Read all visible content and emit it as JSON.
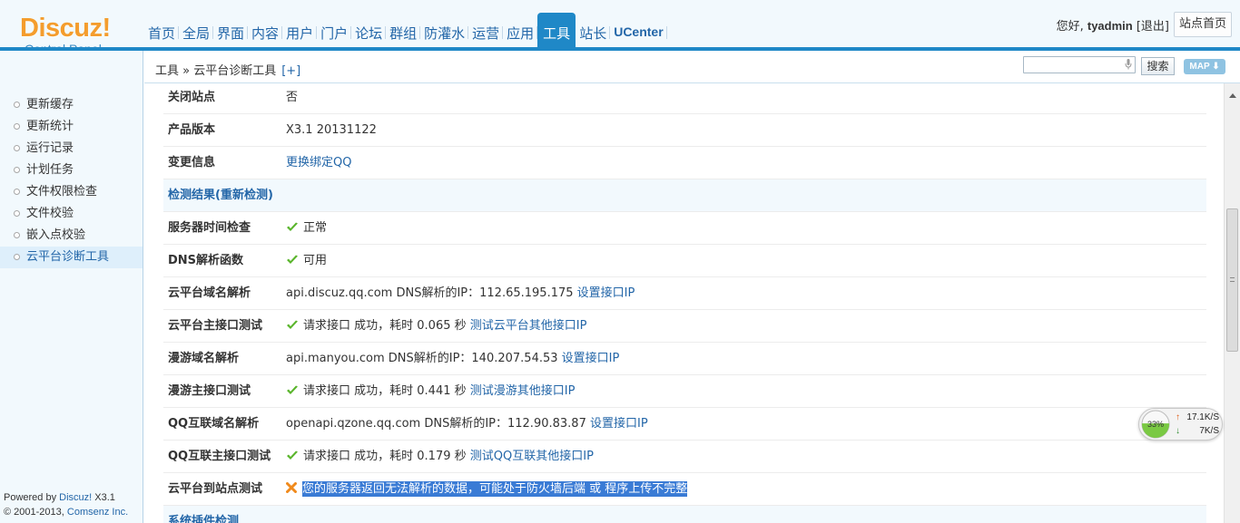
{
  "header": {
    "logo_brand": "Discuz!",
    "logo_sub": "Control Panel",
    "nav": [
      "首页",
      "全局",
      "界面",
      "内容",
      "用户",
      "门户",
      "论坛",
      "群组",
      "防灌水",
      "运营",
      "应用",
      "工具",
      "站长"
    ],
    "nav_ucenter": "UCenter",
    "active_nav": "工具",
    "greeting": "您好,",
    "username": "tyadmin",
    "logout": "[退出]",
    "site_home": "站点首页",
    "accent_color": "#1f88c7",
    "brand_color": "#f49d2d"
  },
  "breadcrumb": {
    "path": "工具 » 云平台诊断工具",
    "plus": "[+]"
  },
  "toolbar": {
    "search_value": "",
    "search_button": "搜索",
    "map_button": "MAP"
  },
  "sidebar": {
    "items": [
      "更新缓存",
      "更新统计",
      "运行记录",
      "计划任务",
      "文件权限检查",
      "文件校验",
      "嵌入点校验",
      "云平台诊断工具"
    ],
    "active_item": "云平台诊断工具",
    "powered_prefix": "Powered by ",
    "powered_brand": "Discuz!",
    "powered_version": " X3.1",
    "copyright_prefix": "© 2001-2013, ",
    "copyright_company": "Comsenz Inc."
  },
  "rows": [
    {
      "label": "关闭站点",
      "text": "否"
    },
    {
      "label": "产品版本",
      "text": "X3.1 20131122"
    },
    {
      "label": "变更信息",
      "link": "更换绑定QQ"
    },
    {
      "label": "检测结果(重新检测)",
      "section": true
    },
    {
      "label": "服务器时间检查",
      "status": "ok",
      "text": "正常"
    },
    {
      "label": "DNS解析函数",
      "status": "ok",
      "text": "可用"
    },
    {
      "label": "云平台域名解析",
      "text": "api.discuz.qq.com DNS解析的IP：112.65.195.175",
      "link": "设置接口IP"
    },
    {
      "label": "云平台主接口测试",
      "status": "ok",
      "text": "请求接口 成功，耗时 0.065 秒",
      "link": "测试云平台其他接口IP"
    },
    {
      "label": "漫游域名解析",
      "text": "api.manyou.com DNS解析的IP：140.207.54.53",
      "link": "设置接口IP"
    },
    {
      "label": "漫游主接口测试",
      "status": "ok",
      "text": "请求接口 成功，耗时 0.441 秒",
      "link": "测试漫游其他接口IP"
    },
    {
      "label": "QQ互联域名解析",
      "text": "openapi.qzone.qq.com DNS解析的IP：112.90.83.87",
      "link": "设置接口IP"
    },
    {
      "label": "QQ互联主接口测试",
      "status": "ok",
      "text": "请求接口 成功，耗时 0.179 秒",
      "link": "测试QQ互联其他接口IP"
    },
    {
      "label": "云平台到站点测试",
      "status": "error",
      "highlight": "您的服务器返回无法解析的数据，可能处于防火墙后端 或 程序上传不完整"
    },
    {
      "label": "系统插件检测",
      "section": true
    }
  ],
  "net_widget": {
    "percent": 33,
    "percent_label": "33%",
    "upload": "17.1K/S",
    "download": "7K/S"
  },
  "colors": {
    "link": "#2366a8",
    "ok_green": "#5ab52c",
    "error_orange": "#f08a1c",
    "selection": "#3a7bd5"
  }
}
